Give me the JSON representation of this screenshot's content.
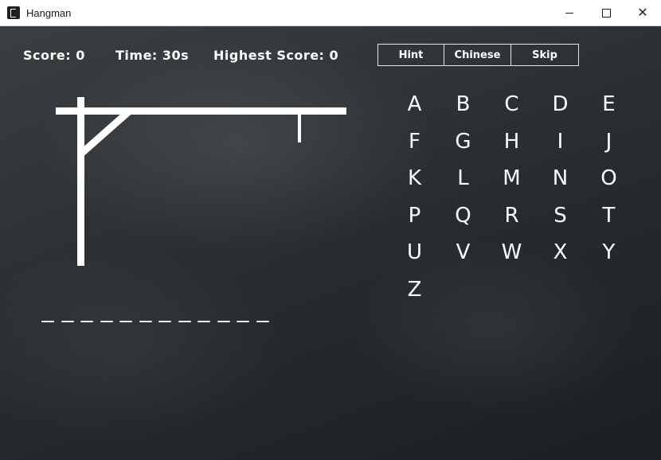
{
  "window": {
    "title": "Hangman",
    "icon": "app-icon",
    "controls": {
      "minimize": "minimize-icon",
      "maximize": "maximize-icon",
      "close": "close-icon"
    }
  },
  "status": {
    "score": "Score: 0",
    "time": "Time: 30s",
    "highest": "Highest Score: 0"
  },
  "buttons": {
    "hint": "Hint",
    "chinese": "Chinese",
    "skip": "Skip"
  },
  "word": {
    "slot_count": 12
  },
  "letters": [
    "A",
    "B",
    "C",
    "D",
    "E",
    "F",
    "G",
    "H",
    "I",
    "J",
    "K",
    "L",
    "M",
    "N",
    "O",
    "P",
    "Q",
    "R",
    "S",
    "T",
    "U",
    "V",
    "W",
    "X",
    "Y",
    "Z"
  ],
  "colors": {
    "chalk": "#ffffff",
    "board": "#2b2f31"
  }
}
